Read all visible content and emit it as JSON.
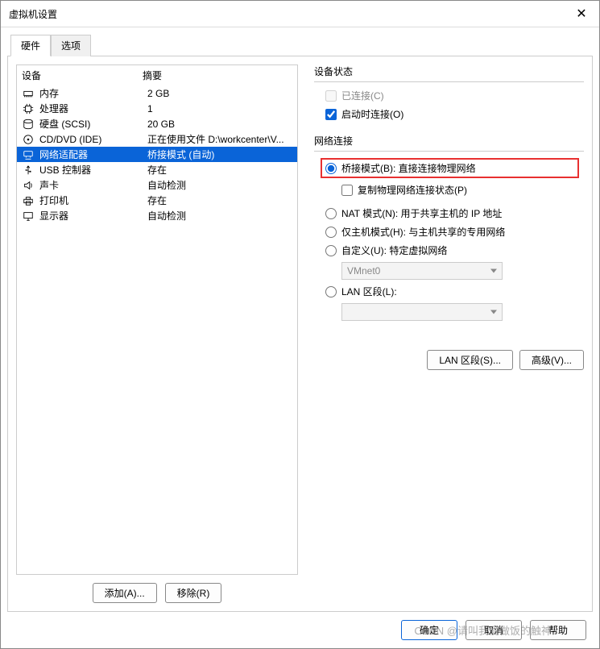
{
  "window": {
    "title": "虚拟机设置",
    "close_x": "✕"
  },
  "tabs": {
    "hardware": "硬件",
    "options": "选项"
  },
  "list_header": {
    "device": "设备",
    "summary": "摘要"
  },
  "devices": [
    {
      "icon": "memory-icon",
      "name": "内存",
      "summary": "2 GB"
    },
    {
      "icon": "cpu-icon",
      "name": "处理器",
      "summary": "1"
    },
    {
      "icon": "disk-icon",
      "name": "硬盘 (SCSI)",
      "summary": "20 GB"
    },
    {
      "icon": "cd-icon",
      "name": "CD/DVD (IDE)",
      "summary": "正在使用文件 D:\\workcenter\\V..."
    },
    {
      "icon": "network-icon",
      "name": "网络适配器",
      "summary": "桥接模式 (自动)",
      "selected": true
    },
    {
      "icon": "usb-icon",
      "name": "USB 控制器",
      "summary": "存在"
    },
    {
      "icon": "sound-icon",
      "name": "声卡",
      "summary": "自动检测"
    },
    {
      "icon": "printer-icon",
      "name": "打印机",
      "summary": "存在"
    },
    {
      "icon": "display-icon",
      "name": "显示器",
      "summary": "自动检测"
    }
  ],
  "buttons": {
    "add": "添加(A)...",
    "remove": "移除(R)"
  },
  "device_status": {
    "title": "设备状态",
    "connected": "已连接(C)",
    "connect_on_poweron": "启动时连接(O)"
  },
  "network": {
    "title": "网络连接",
    "bridged": "桥接模式(B): 直接连接物理网络",
    "replicate": "复制物理网络连接状态(P)",
    "nat": "NAT 模式(N): 用于共享主机的 IP 地址",
    "hostonly": "仅主机模式(H): 与主机共享的专用网络",
    "custom": "自定义(U): 特定虚拟网络",
    "custom_value": "VMnet0",
    "lan_segment": "LAN 区段(L):",
    "lan_segment_value": ""
  },
  "lan_buttons": {
    "segments": "LAN 区段(S)...",
    "advanced": "高级(V)..."
  },
  "footer": {
    "ok": "确定",
    "cancel": "取消",
    "help": "帮助"
  },
  "watermark": "CSDN @请叫我爱做饭的触神"
}
